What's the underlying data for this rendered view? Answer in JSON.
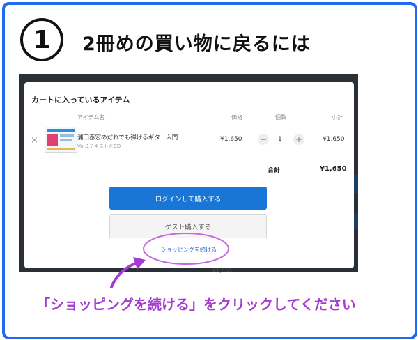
{
  "step": {
    "number": "1",
    "title": "2冊めの買い物に戻るには"
  },
  "modal": {
    "title": "カートに入っているアイテム",
    "columns": {
      "item": "アイテム名",
      "price": "価格",
      "quantity": "個数",
      "subtotal": "小計"
    },
    "item": {
      "name": "浦田泰宏のだれでも弾けるギター入門",
      "subtitle": "Vol.1テキストとCD",
      "price": "¥1,650",
      "quantity": "1",
      "subtotal": "¥1,650",
      "remove_icon": "×",
      "decrease_icon": "−",
      "increase_icon": "+"
    },
    "total_label": "合計",
    "total_value": "¥1,650",
    "login_button": "ログインして購入する",
    "guest_button": "ゲスト購入する",
    "continue_link": "ショッピングを続ける"
  },
  "background_price": "¥1,650",
  "caption": "「ショッピングを続ける」をクリックしてください",
  "colors": {
    "frame": "#1f6cf2",
    "primary_button": "#1976d6",
    "annotation": "#a63bd1"
  }
}
